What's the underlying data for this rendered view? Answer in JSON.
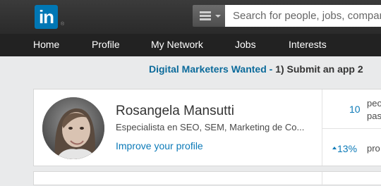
{
  "header": {
    "logo_text": "in",
    "logo_mark": "®",
    "search": {
      "placeholder": "Search for people, jobs, companies..."
    }
  },
  "nav": {
    "items": [
      {
        "label": "Home"
      },
      {
        "label": "Profile"
      },
      {
        "label": "My Network"
      },
      {
        "label": "Jobs"
      },
      {
        "label": "Interests"
      }
    ]
  },
  "banner": {
    "title": "Digital Marketers Wanted - ",
    "text": "1) Submit an app 2"
  },
  "profile": {
    "name": "Rosangela Mansutti",
    "headline": "Especialista en SEO, SEM, Marketing de Co...",
    "improve_link": "Improve your profile"
  },
  "stats": {
    "views": {
      "value": "10",
      "label_line1": "peo",
      "label_line2": "pas"
    },
    "rank": {
      "value": "13%",
      "label": "pro"
    }
  },
  "colors": {
    "brand": "#0077b5",
    "link": "#0c7ab8",
    "topbar": "#333333",
    "navbar": "#222222",
    "background": "#e9eaeb"
  }
}
